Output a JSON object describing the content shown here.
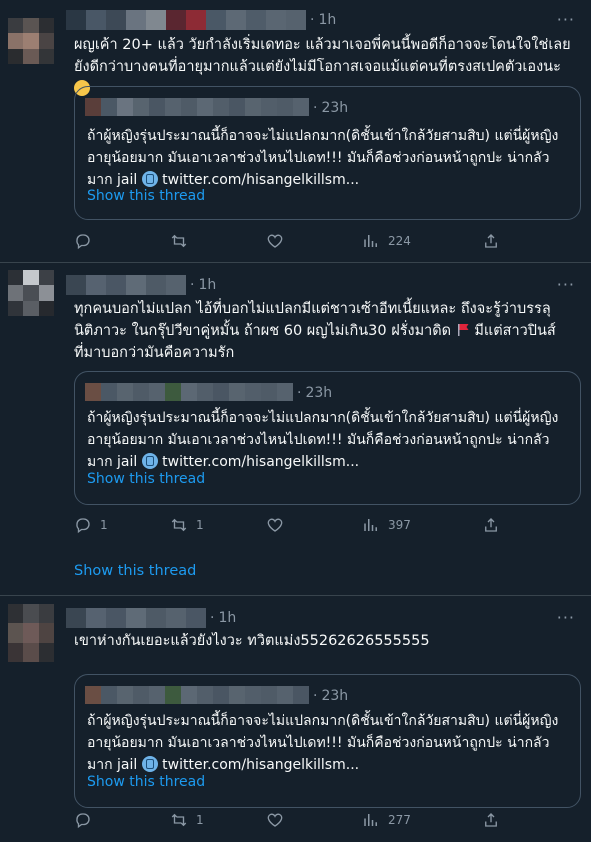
{
  "tweets": [
    {
      "time": "1h",
      "text": "ผญเค้า 20+ แล้ว วัยกำลังเริ่มเดทอะ แล้วมาเจอพี่คนนี้พอดีก็อาจจะโดนใจใช่เลย ยังดีกว่าบางคนที่อายุมากแล้วแต่ยังไม่มีโอกาสเจอแม้แต่คนที่ตรงสเปคตัวเองนะ",
      "emoji": "relieved-face-emoji",
      "quote": {
        "time": "23h",
        "text": "ถ้าผู้หญิงรุ่นประมาณนี้ก็อาจจะไม่แปลกมาก(ดิชั้นเข้าใกล้วัยสามสิบ) แต่นี่ผู้หญิงอายุน้อยมาก มันเอาเวลาช่วงไหนไปเดท!!! มันก็คือช่วงก่อนหน้าถูกปะ น่ากลัวมาก jail",
        "link": "twitter.com/hisangelkillsm...",
        "show_thread": "Show this thread"
      },
      "actions": {
        "reply": "",
        "retweet": "",
        "like": "",
        "views": "224"
      }
    },
    {
      "time": "1h",
      "text": "ทุกคนบอกไม่แปลก ไอ้ที่บอกไม่แปลกมีแต่ชาวเซ้าอีทเนี้ยแหละ ถึงจะรู้ว่าบรรลุนิติภาวะ ในกรุ๊ปวีขาคู่หมั้น ถ้าผช 60 ผญไม่เกิน30 ฝรั่งมาดิด",
      "text_after_flag": " มีแต่สาวปินส์ที่มาบอกว่ามันคือความรัก",
      "emoji": "red-flag-emoji",
      "quote": {
        "time": "23h",
        "text": "ถ้าผู้หญิงรุ่นประมาณนี้ก็อาจจะไม่แปลกมาก(ดิชั้นเข้าใกล้วัยสามสิบ) แต่นี่ผู้หญิงอายุน้อยมาก มันเอาเวลาช่วงไหนไปเดท!!! มันก็คือช่วงก่อนหน้าถูกปะ น่ากลัวมาก jail",
        "link": "twitter.com/hisangelkillsm...",
        "show_thread": "Show this thread"
      },
      "actions": {
        "reply": "1",
        "retweet": "1",
        "like": "",
        "views": "397"
      },
      "show_thread": "Show this thread"
    },
    {
      "time": "1h",
      "text": "เขาห่างกันเยอะแล้วยังไงวะ ทวิตแม่ง55262626555555",
      "quote": {
        "time": "23h",
        "text": "ถ้าผู้หญิงรุ่นประมาณนี้ก็อาจจะไม่แปลกมาก(ดิชั้นเข้าใกล้วัยสามสิบ) แต่นี่ผู้หญิงอายุน้อยมาก มันเอาเวลาช่วงไหนไปเดท!!! มันก็คือช่วงก่อนหน้าถูกปะ น่ากลัวมาก jail",
        "link": "twitter.com/hisangelkillsm...",
        "show_thread": "Show this thread"
      },
      "actions": {
        "reply": "",
        "retweet": "1",
        "like": "",
        "views": "277"
      }
    }
  ],
  "colors": {
    "background": "#15202b",
    "accent": "#1d9bf0",
    "muted": "#8b98a5",
    "border": "#38444d"
  }
}
